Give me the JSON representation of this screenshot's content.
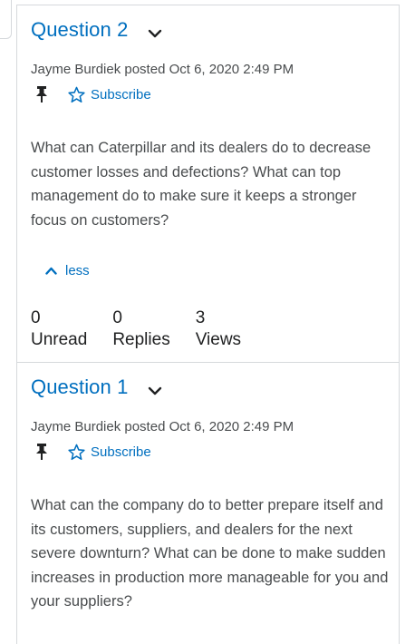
{
  "posts": [
    {
      "title": "Question 2",
      "meta": "Jayme Burdiek posted Oct 6, 2020 2:49 PM",
      "subscribe_label": "Subscribe",
      "body": "What can Caterpillar and its dealers do to decrease customer losses and defections? What can top management do to make sure it keeps a stronger focus on customers?",
      "less_label": "less",
      "stats": [
        {
          "value": "0",
          "label": "Unread"
        },
        {
          "value": "0",
          "label": "Replies"
        },
        {
          "value": "3",
          "label": "Views"
        }
      ]
    },
    {
      "title": "Question 1",
      "meta": "Jayme Burdiek posted Oct 6, 2020 2:49 PM",
      "subscribe_label": "Subscribe",
      "body": "What can the company do to better prepare itself and its customers, suppliers, and dealers for the next severe downturn? What can be done to make sudden increases in production more manageable for you and your suppliers?"
    }
  ],
  "colors": {
    "link": "#006fbf",
    "text": "#494c4e",
    "border": "#d6d9dc"
  },
  "icons": [
    "chevron-down-icon",
    "pin-icon",
    "star-icon",
    "chevron-up-icon"
  ]
}
